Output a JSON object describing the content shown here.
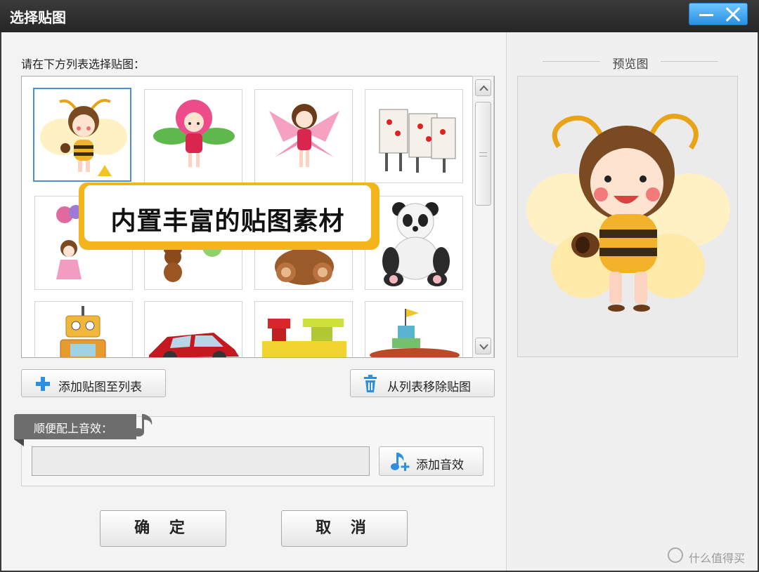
{
  "window": {
    "title": "选择贴图"
  },
  "list": {
    "instruction": "请在下方列表选择贴图：",
    "items": [
      {
        "icon": "bee-girl-sticker",
        "selected": true
      },
      {
        "icon": "flower-girl-sticker",
        "selected": false
      },
      {
        "icon": "fairy-girl-sticker",
        "selected": false
      },
      {
        "icon": "card-soldiers-sticker",
        "selected": false
      },
      {
        "icon": "balloon-girl-sticker",
        "selected": false
      },
      {
        "icon": "teddy-bear-balloon-sticker",
        "selected": false
      },
      {
        "icon": "brown-bear-sticker",
        "selected": false
      },
      {
        "icon": "panda-sticker",
        "selected": false
      },
      {
        "icon": "robot-sticker",
        "selected": false
      },
      {
        "icon": "red-car-sticker",
        "selected": false
      },
      {
        "icon": "toy-blocks-sticker",
        "selected": false
      },
      {
        "icon": "castle-sticker",
        "selected": false
      }
    ]
  },
  "banner": {
    "text": "内置丰富的贴图素材"
  },
  "actions": {
    "add_label": "添加贴图至列表",
    "remove_label": "从列表移除贴图"
  },
  "sound": {
    "section_label": "顺便配上音效：",
    "value": "",
    "add_label": "添加音效"
  },
  "footer": {
    "ok_label": "确 定",
    "cancel_label": "取 消"
  },
  "preview": {
    "title": "预览图",
    "icon": "bee-girl-sticker"
  },
  "watermark": {
    "text": "什么值得买"
  },
  "colors": {
    "titlebar": "#2e2e2e",
    "accent_blue": "#2a8fe3",
    "banner_yellow": "#f3b51b",
    "selection_border": "#4c8fd8"
  }
}
